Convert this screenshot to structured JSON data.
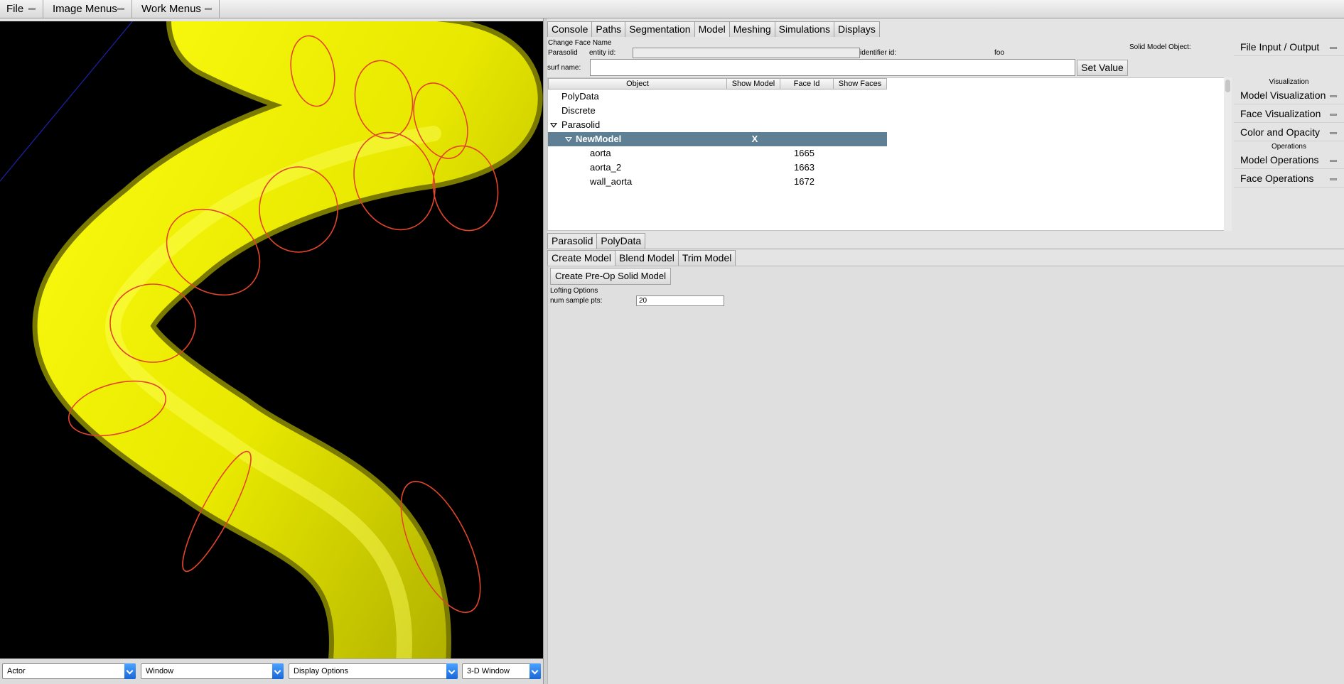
{
  "menubar": {
    "file": "File",
    "image_menus": "Image Menus",
    "work_menus": "Work Menus"
  },
  "viewport": {
    "selects": {
      "actor": "Actor",
      "window": "Window",
      "display": "Display Options",
      "view": "3-D Window"
    },
    "colors": {
      "background": "#000000",
      "model": "#f2f200",
      "contour": "#e2442c",
      "axis": "#2020aa"
    }
  },
  "tabs": [
    "Console",
    "Paths",
    "Segmentation",
    "Model",
    "Meshing",
    "Simulations",
    "Displays"
  ],
  "active_tab": "Model",
  "header": {
    "change_face_name": "Change Face Name",
    "parasolid": "Parasolid",
    "entity_id_label": "entity id:",
    "entity_id_value": "",
    "identifier_id_label": "identifier id:",
    "identifier_id_value": "foo",
    "solid_model_object": "Solid Model Object:",
    "surf_name_label": "surf name:",
    "surf_name_value": "",
    "set_value": "Set Value"
  },
  "tree": {
    "columns": [
      "Object",
      "Show Model",
      "Face Id",
      "Show Faces"
    ],
    "rows": [
      {
        "label": "PolyData",
        "show_model": "",
        "face_id": ""
      },
      {
        "label": "Discrete",
        "show_model": "",
        "face_id": ""
      },
      {
        "label": "Parasolid",
        "show_model": "",
        "face_id": ""
      },
      {
        "label": "NewModel",
        "show_model": "X",
        "face_id": ""
      },
      {
        "label": "aorta",
        "show_model": "",
        "face_id": "1665"
      },
      {
        "label": "aorta_2",
        "show_model": "",
        "face_id": "1663"
      },
      {
        "label": "wall_aorta",
        "show_model": "",
        "face_id": "1672"
      }
    ]
  },
  "right_panel": {
    "file_io": "File Input / Output",
    "visualization_heading": "Visualization",
    "model_visualization": "Model Visualization",
    "face_visualization": "Face Visualization",
    "color_opacity": "Color and Opacity",
    "operations_heading": "Operations",
    "model_operations": "Model Operations",
    "face_operations": "Face Operations"
  },
  "kernel_tabs": [
    "Parasolid",
    "PolyData"
  ],
  "model_tabs": [
    "Create Model",
    "Blend Model",
    "Trim Model"
  ],
  "create_model": {
    "button": "Create Pre-Op Solid Model",
    "lofting_options": "Lofting Options",
    "num_sample_label": "num sample pts:",
    "num_sample_value": "20"
  }
}
